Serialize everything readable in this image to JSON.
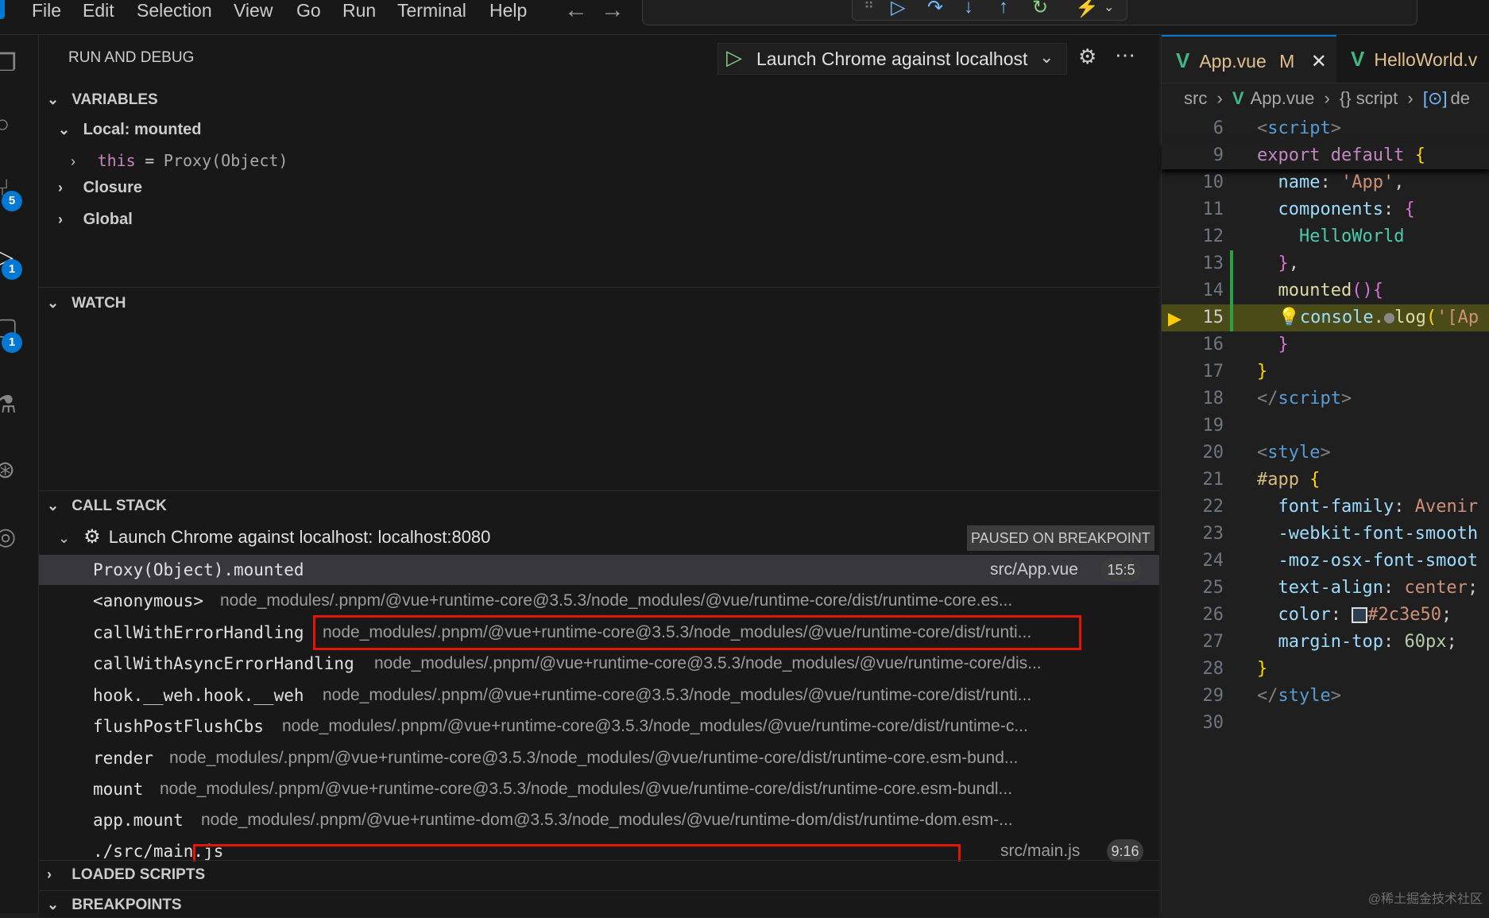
{
  "menu": [
    "File",
    "Edit",
    "Selection",
    "View",
    "Go",
    "Run",
    "Terminal",
    "Help"
  ],
  "run_debug": {
    "title": "RUN AND DEBUG",
    "launch_config": "Launch Chrome against localhost"
  },
  "variables": {
    "header": "VARIABLES",
    "scope_local": "Local: mounted",
    "this_name": "this",
    "this_eq": "=",
    "this_value": "Proxy(Object)",
    "closure": "Closure",
    "global": "Global"
  },
  "watch": {
    "header": "WATCH"
  },
  "call_stack": {
    "header": "CALL STACK",
    "session": "Launch Chrome against localhost: localhost:8080",
    "status": "PAUSED ON BREAKPOINT",
    "frames": [
      {
        "fn": "Proxy(Object).mounted",
        "path": "src/App.vue",
        "pos": "15:5"
      },
      {
        "fn": "<anonymous>",
        "path": "node_modules/.pnpm/@vue+runtime-core@3.5.3/node_modules/@vue/runtime-core/dist/runtime-core.es..."
      },
      {
        "fn": "callWithErrorHandling",
        "path": "node_modules/.pnpm/@vue+runtime-core@3.5.3/node_modules/@vue/runtime-core/dist/runti..."
      },
      {
        "fn": "callWithAsyncErrorHandling",
        "path": "node_modules/.pnpm/@vue+runtime-core@3.5.3/node_modules/@vue/runtime-core/dis..."
      },
      {
        "fn": "hook.__weh.hook.__weh",
        "path": "node_modules/.pnpm/@vue+runtime-core@3.5.3/node_modules/@vue/runtime-core/dist/runti..."
      },
      {
        "fn": "flushPostFlushCbs",
        "path": "node_modules/.pnpm/@vue+runtime-core@3.5.3/node_modules/@vue/runtime-core/dist/runtime-c..."
      },
      {
        "fn": "render",
        "path": "node_modules/.pnpm/@vue+runtime-core@3.5.3/node_modules/@vue/runtime-core/dist/runtime-core.esm-bund..."
      },
      {
        "fn": "mount",
        "path": "node_modules/.pnpm/@vue+runtime-core@3.5.3/node_modules/@vue/runtime-core/dist/runtime-core.esm-bundl..."
      },
      {
        "fn": "app.mount",
        "path": "node_modules/.pnpm/@vue+runtime-dom@3.5.3/node_modules/@vue/runtime-dom/dist/runtime-dom.esm-..."
      },
      {
        "fn": "./src/main.js",
        "path": "src/main.js",
        "pos": "9:16"
      }
    ]
  },
  "loaded_scripts": {
    "header": "LOADED SCRIPTS"
  },
  "breakpoints": {
    "header": "BREAKPOINTS"
  },
  "editor": {
    "tabs": [
      {
        "label": "App.vue",
        "modified": "M"
      },
      {
        "label": "HelloWorld.v"
      }
    ],
    "breadcrumb": [
      "src",
      "App.vue",
      "{} script",
      "de"
    ],
    "line_numbers": [
      "6",
      "9",
      "10",
      "11",
      "12",
      "13",
      "14",
      "15",
      "16",
      "17",
      "18",
      "19",
      "20",
      "21",
      "22",
      "23",
      "24",
      "25",
      "26",
      "27",
      "28",
      "29",
      "30"
    ]
  },
  "watermark": "@稀土掘金技术社区",
  "colors": {
    "accent": "#0078d4",
    "highlight_box": "#e51400",
    "breakpoint": "#ffcc00",
    "vue": "#41b883"
  }
}
